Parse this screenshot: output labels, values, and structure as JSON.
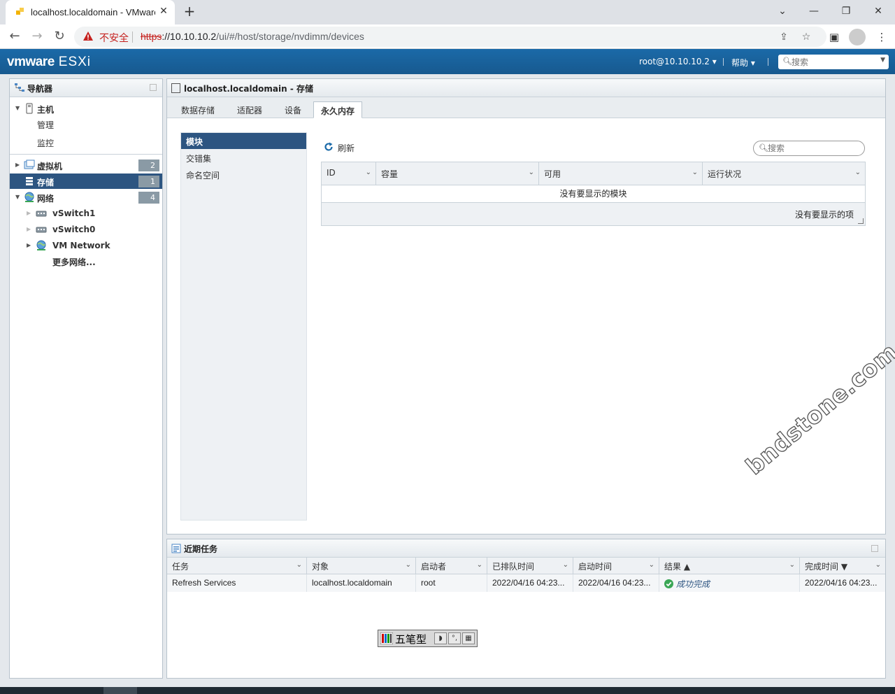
{
  "browser": {
    "tab_title": "localhost.localdomain - VMware ESXi",
    "new_tab": "+",
    "window_controls": {
      "minimize": "⌄",
      "min2": "—",
      "restore": "❐",
      "close": "✕"
    },
    "security_label": "不安全",
    "url_scheme": "https",
    "url_host": "://10.10.10.2",
    "url_path": "/ui/#/host/storage/nvdimm/devices"
  },
  "header": {
    "logo_vm": "vmware",
    "logo_product": "ESXi",
    "user": "root@10.10.10.2 ▾",
    "help": "帮助 ▾",
    "search_placeholder": "搜索"
  },
  "navigator": {
    "title": "导航器",
    "host": {
      "label": "主机",
      "children": [
        "管理",
        "监控"
      ]
    },
    "vms": {
      "label": "虚拟机",
      "count": "2"
    },
    "storage": {
      "label": "存储",
      "count": "1"
    },
    "network": {
      "label": "网络",
      "count": "4",
      "children": [
        "vSwitch1",
        "vSwitch0",
        "VM Network",
        "更多网络..."
      ]
    }
  },
  "content": {
    "title": "localhost.localdomain - 存储",
    "tabs": [
      "数据存储",
      "适配器",
      "设备",
      "永久内存"
    ],
    "subnav": [
      "模块",
      "交错集",
      "命名空间"
    ],
    "refresh_label": "刷新",
    "search_placeholder": "搜索",
    "grid": {
      "columns": [
        "ID",
        "容量",
        "可用",
        "运行状况"
      ],
      "empty_message": "没有要显示的模块",
      "footer": "没有要显示的项"
    }
  },
  "tasks": {
    "title": "近期任务",
    "columns": [
      "任务",
      "对象",
      "启动者",
      "已排队时间",
      "启动时间",
      "结果 ▲",
      "完成时间 ▼"
    ],
    "rows": [
      {
        "task": "Refresh Services",
        "object": "localhost.localdomain",
        "initiator": "root",
        "queued": "2022/04/16 04:23...",
        "started": "2022/04/16 04:23...",
        "result": "成功完成",
        "completed": "2022/04/16 04:23..."
      }
    ]
  },
  "ime": {
    "mode": "五笔型"
  },
  "watermark": "bndstone.com",
  "colors": {
    "esxi_header": "#1b6aa8",
    "selected_row": "#2d5581",
    "insecure_red": "#c5221f",
    "success_green": "#3aa655"
  }
}
